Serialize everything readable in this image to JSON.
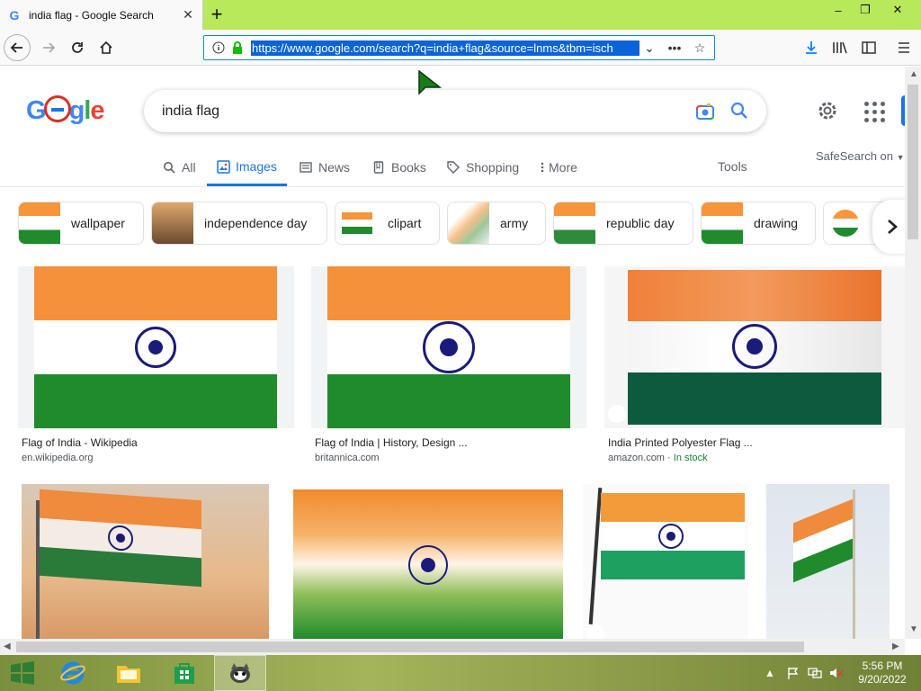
{
  "browser": {
    "tab_title": "india flag - Google Search",
    "tab_favicon": "G",
    "url": "https://www.google.com/search?q=india+flag&source=lnms&tbm=isch",
    "win_minimize": "–",
    "win_restore": "❐",
    "win_close": "✕",
    "newtab": "+"
  },
  "search": {
    "query": "india flag"
  },
  "tabs": [
    {
      "label": "All"
    },
    {
      "label": "Images"
    },
    {
      "label": "News"
    },
    {
      "label": "Books"
    },
    {
      "label": "Shopping"
    },
    {
      "label": "More"
    }
  ],
  "tools_label": "Tools",
  "safesearch_label": "SafeSearch on",
  "chips": [
    {
      "label": "wallpaper"
    },
    {
      "label": "independence day"
    },
    {
      "label": "clipart"
    },
    {
      "label": "army"
    },
    {
      "label": "republic day"
    },
    {
      "label": "drawing"
    }
  ],
  "results": [
    {
      "title": "Flag of India - Wikipedia",
      "source": "en.wikipedia.org"
    },
    {
      "title": "Flag of India | History, Design ...",
      "source": "britannica.com"
    },
    {
      "title": "India Printed Polyester Flag ...",
      "source": "amazon.com",
      "stock": "In stock"
    }
  ],
  "taskbar": {
    "time": "5:56 PM",
    "date": "9/20/2022"
  },
  "colors": {
    "saffron": "#ff9933",
    "green": "#138808",
    "navy": "#000080",
    "accent": "#1a73e8",
    "titlebar": "#b7e95b"
  }
}
